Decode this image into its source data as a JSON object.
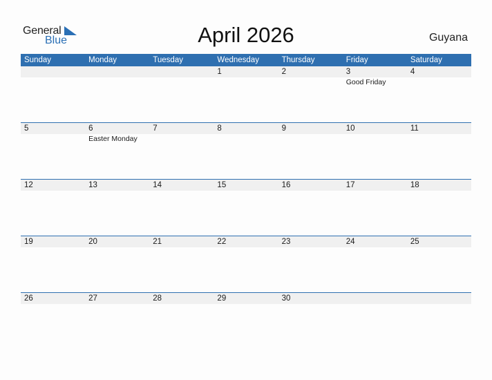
{
  "brand": {
    "general": "General",
    "blue": "Blue",
    "accent": "#2e6fb0"
  },
  "title": "April 2026",
  "country": "Guyana",
  "weekdays": [
    "Sunday",
    "Monday",
    "Tuesday",
    "Wednesday",
    "Thursday",
    "Friday",
    "Saturday"
  ],
  "weeks": [
    [
      {
        "day": ""
      },
      {
        "day": ""
      },
      {
        "day": ""
      },
      {
        "day": "1"
      },
      {
        "day": "2"
      },
      {
        "day": "3",
        "holiday": "Good Friday"
      },
      {
        "day": "4"
      }
    ],
    [
      {
        "day": "5"
      },
      {
        "day": "6",
        "holiday": "Easter Monday"
      },
      {
        "day": "7"
      },
      {
        "day": "8"
      },
      {
        "day": "9"
      },
      {
        "day": "10"
      },
      {
        "day": "11"
      }
    ],
    [
      {
        "day": "12"
      },
      {
        "day": "13"
      },
      {
        "day": "14"
      },
      {
        "day": "15"
      },
      {
        "day": "16"
      },
      {
        "day": "17"
      },
      {
        "day": "18"
      }
    ],
    [
      {
        "day": "19"
      },
      {
        "day": "20"
      },
      {
        "day": "21"
      },
      {
        "day": "22"
      },
      {
        "day": "23"
      },
      {
        "day": "24"
      },
      {
        "day": "25"
      }
    ],
    [
      {
        "day": "26"
      },
      {
        "day": "27"
      },
      {
        "day": "28"
      },
      {
        "day": "29"
      },
      {
        "day": "30"
      },
      {
        "day": ""
      },
      {
        "day": ""
      }
    ]
  ]
}
